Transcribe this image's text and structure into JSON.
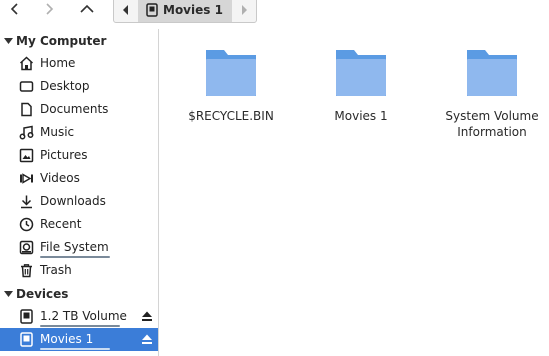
{
  "toolbar": {
    "back_icon": "chevron-left-icon",
    "forward_icon": "chevron-right-icon",
    "up_icon": "chevron-up-icon",
    "path": {
      "current": "Movies 1"
    }
  },
  "sidebar": {
    "sections": [
      {
        "title": "My Computer",
        "items": [
          {
            "label": "Home",
            "icon": "home-icon"
          },
          {
            "label": "Desktop",
            "icon": "desktop-icon"
          },
          {
            "label": "Documents",
            "icon": "documents-icon"
          },
          {
            "label": "Music",
            "icon": "music-icon"
          },
          {
            "label": "Pictures",
            "icon": "pictures-icon"
          },
          {
            "label": "Videos",
            "icon": "videos-icon"
          },
          {
            "label": "Downloads",
            "icon": "downloads-icon"
          },
          {
            "label": "Recent",
            "icon": "recent-icon"
          },
          {
            "label": "File System",
            "icon": "filesystem-icon"
          },
          {
            "label": "Trash",
            "icon": "trash-icon"
          }
        ]
      },
      {
        "title": "Devices",
        "items": [
          {
            "label": "1.2 TB Volume",
            "icon": "drive-icon"
          },
          {
            "label": "Movies 1",
            "icon": "drive-icon",
            "selected": true
          }
        ]
      }
    ]
  },
  "files": [
    {
      "name": "$RECYCLE.BIN",
      "icon": "folder-icon"
    },
    {
      "name": "Movies 1",
      "icon": "folder-icon"
    },
    {
      "name": "System Volume Information",
      "icon": "folder-icon"
    }
  ],
  "colors": {
    "accent": "#3b7dd8",
    "folder": "#8fb8ee",
    "folder_tab": "#5b9be3"
  }
}
